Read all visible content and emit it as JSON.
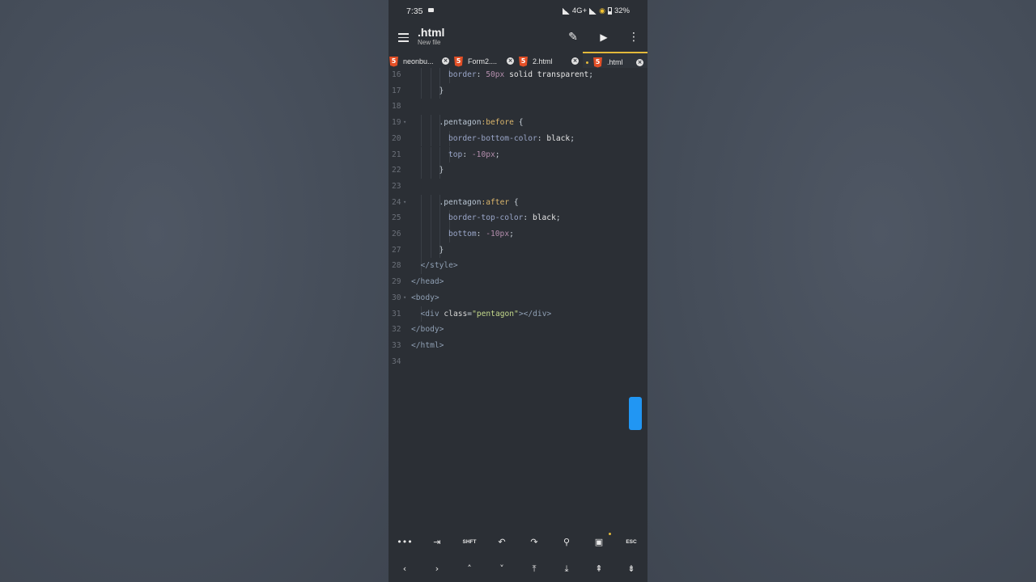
{
  "status_bar": {
    "time": "7:35",
    "network": "4G+",
    "battery": "32%"
  },
  "app_bar": {
    "title": ".html",
    "subtitle": "New file"
  },
  "tabs": [
    {
      "label": "neonbu...",
      "modified": false,
      "active": false
    },
    {
      "label": "Form2....",
      "modified": false,
      "active": false
    },
    {
      "label": "2.html",
      "modified": false,
      "active": false
    },
    {
      "label": ".html",
      "modified": true,
      "active": true
    }
  ],
  "tab_icon_glyph": "5",
  "close_glyph": "×",
  "editor": {
    "lines": [
      {
        "n": "16",
        "fold": "",
        "tokens": [
          [
            "border",
            "prop"
          ],
          [
            ": ",
            "punc"
          ],
          [
            "50px",
            "num"
          ],
          [
            " solid transparent",
            "val"
          ],
          [
            ";",
            "punc"
          ]
        ]
      },
      {
        "n": "17",
        "fold": "",
        "tokens": [
          [
            "}",
            "punc"
          ]
        ]
      },
      {
        "n": "18",
        "fold": "",
        "tokens": []
      },
      {
        "n": "19",
        "fold": "▾",
        "tokens": [
          [
            ".pentagon",
            "sel"
          ],
          [
            ":before",
            "pseudo"
          ],
          [
            " {",
            "punc"
          ]
        ]
      },
      {
        "n": "20",
        "fold": "",
        "tokens": [
          [
            "border-bottom-color",
            "prop"
          ],
          [
            ": ",
            "punc"
          ],
          [
            "black",
            "val"
          ],
          [
            ";",
            "punc"
          ]
        ]
      },
      {
        "n": "21",
        "fold": "",
        "tokens": [
          [
            "top",
            "prop"
          ],
          [
            ": ",
            "punc"
          ],
          [
            "-10px",
            "num"
          ],
          [
            ";",
            "punc"
          ]
        ]
      },
      {
        "n": "22",
        "fold": "",
        "tokens": [
          [
            "}",
            "punc"
          ]
        ]
      },
      {
        "n": "23",
        "fold": "",
        "tokens": []
      },
      {
        "n": "24",
        "fold": "▾",
        "tokens": [
          [
            ".pentagon",
            "sel"
          ],
          [
            ":after",
            "pseudo"
          ],
          [
            " {",
            "punc"
          ]
        ]
      },
      {
        "n": "25",
        "fold": "",
        "tokens": [
          [
            "border-top-color",
            "prop"
          ],
          [
            ": ",
            "punc"
          ],
          [
            "black",
            "val"
          ],
          [
            ";",
            "punc"
          ]
        ]
      },
      {
        "n": "26",
        "fold": "",
        "tokens": [
          [
            "bottom",
            "prop"
          ],
          [
            ": ",
            "punc"
          ],
          [
            "-10px",
            "num"
          ],
          [
            ";",
            "punc"
          ]
        ]
      },
      {
        "n": "27",
        "fold": "",
        "tokens": [
          [
            "}",
            "punc"
          ]
        ]
      },
      {
        "n": "28",
        "fold": "",
        "tokens": [
          [
            "</style>",
            "tag"
          ]
        ]
      },
      {
        "n": "29",
        "fold": "",
        "tokens": [
          [
            "</head>",
            "tag"
          ]
        ]
      },
      {
        "n": "30",
        "fold": "▾",
        "tokens": [
          [
            "<body>",
            "tag"
          ]
        ]
      },
      {
        "n": "31",
        "fold": "",
        "tokens": [
          [
            "<div ",
            "tag"
          ],
          [
            "class",
            "attr"
          ],
          [
            "=",
            "punc"
          ],
          [
            "\"pentagon\"",
            "str"
          ],
          [
            "></div>",
            "tag"
          ]
        ]
      },
      {
        "n": "32",
        "fold": "",
        "tokens": [
          [
            "</body>",
            "tag"
          ]
        ]
      },
      {
        "n": "33",
        "fold": "",
        "tokens": [
          [
            "</html>",
            "tag"
          ]
        ]
      },
      {
        "n": "34",
        "fold": "",
        "tokens": []
      }
    ],
    "indent_levels": [
      4,
      3,
      0,
      3,
      4,
      4,
      3,
      0,
      3,
      4,
      4,
      3,
      1,
      0,
      0,
      1,
      0,
      0,
      0
    ]
  },
  "keyboard": {
    "row1": [
      {
        "name": "more-key",
        "label": "•••",
        "txt": false
      },
      {
        "name": "tab-key",
        "label": "⇥",
        "txt": false
      },
      {
        "name": "shift-key",
        "label": "SHFT",
        "txt": true
      },
      {
        "name": "undo-key",
        "label": "↶",
        "txt": false
      },
      {
        "name": "redo-key",
        "label": "↷",
        "txt": false
      },
      {
        "name": "search-key",
        "label": "⚲",
        "txt": false
      },
      {
        "name": "save-key",
        "label": "▣",
        "txt": false
      },
      {
        "name": "esc-key",
        "label": "ESC",
        "txt": true
      }
    ],
    "row2": [
      {
        "name": "arrow-left-key",
        "label": "‹",
        "txt": false
      },
      {
        "name": "arrow-right-key",
        "label": "›",
        "txt": false
      },
      {
        "name": "arrow-up-key",
        "label": "˄",
        "txt": false
      },
      {
        "name": "arrow-down-key",
        "label": "˅",
        "txt": false
      },
      {
        "name": "doc-start-key",
        "label": "⤒",
        "txt": false
      },
      {
        "name": "doc-end-key",
        "label": "⤓",
        "txt": false
      },
      {
        "name": "page-up-key",
        "label": "⇞",
        "txt": false
      },
      {
        "name": "page-down-key",
        "label": "⇟",
        "txt": false
      }
    ]
  },
  "colors": {
    "accent": "#e2b93b",
    "scroll_thumb": "#2196f3",
    "html_icon": "#e34f26",
    "editor_bg": "#2b2f35"
  }
}
